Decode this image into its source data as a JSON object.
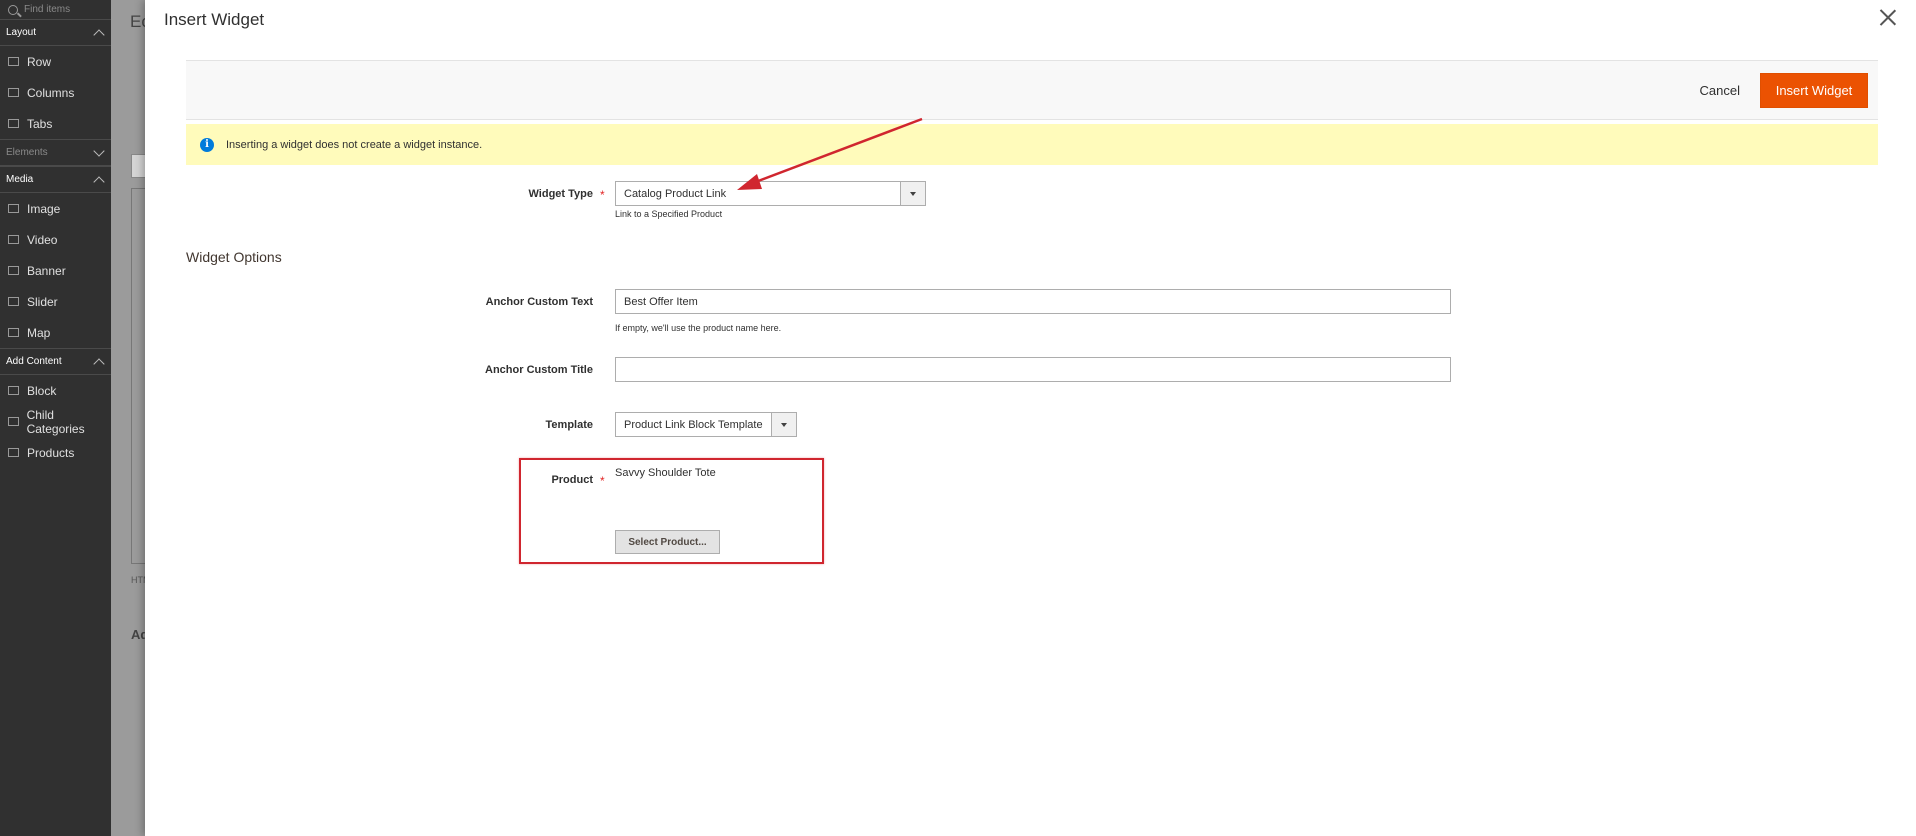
{
  "panel": {
    "search_placeholder": "Find items",
    "groups": [
      {
        "label": "Layout",
        "items": [
          "Row",
          "Columns",
          "Tabs"
        ]
      },
      {
        "label": "Elements",
        "items": []
      },
      {
        "label": "Media",
        "items": [
          "Image",
          "Video",
          "Banner",
          "Slider",
          "Map"
        ]
      },
      {
        "label": "Add Content",
        "items": [
          "Block",
          "Child Categories",
          "Products"
        ]
      }
    ]
  },
  "background": {
    "heading_fragment": "Ec",
    "html_fragment": "HTM",
    "ad_fragment": "Ad"
  },
  "modal": {
    "title": "Insert Widget",
    "cancel_label": "Cancel",
    "insert_label": "Insert Widget",
    "notice": "Inserting a widget does not create a widget instance.",
    "widget_type_label": "Widget Type",
    "widget_type_value": "Catalog Product Link",
    "widget_type_note": "Link to a Specified Product",
    "options_title": "Widget Options",
    "anchor_text_label": "Anchor Custom Text",
    "anchor_text_value": "Best Offer Item",
    "anchor_text_note": "If empty, we'll use the product name here.",
    "anchor_title_label": "Anchor Custom Title",
    "anchor_title_value": "",
    "template_label": "Template",
    "template_value": "Product Link Block Template",
    "product_label": "Product",
    "product_value": "Savvy Shoulder Tote",
    "select_product_label": "Select Product...",
    "required_mark": "*"
  },
  "colors": {
    "accent": "#eb5202",
    "annotation": "#d0262f",
    "notice_bg": "#fffbbb",
    "panel_bg": "#303030"
  }
}
